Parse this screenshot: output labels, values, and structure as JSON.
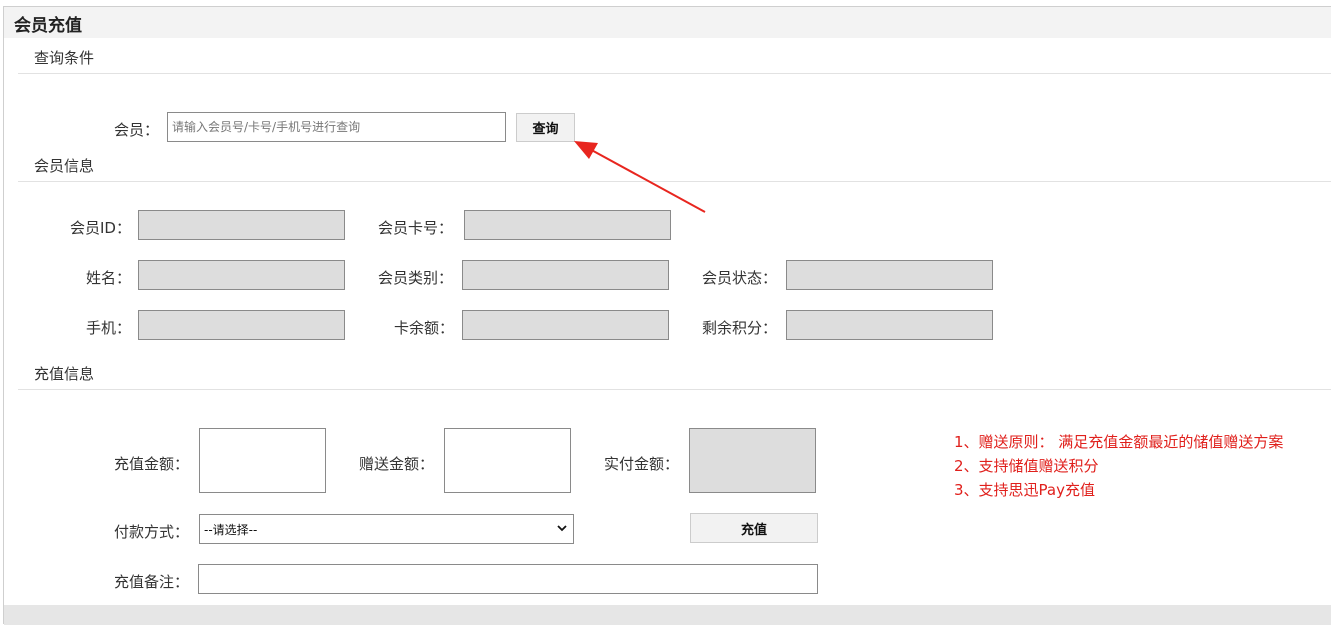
{
  "page": {
    "title": "会员充值"
  },
  "query_section": {
    "title": "查询条件",
    "member_label": "会员：",
    "member_placeholder": "请输入会员号/卡号/手机号进行查询",
    "member_value": "",
    "search_button": "查询"
  },
  "member_info": {
    "title": "会员信息",
    "fields": {
      "member_id": {
        "label": "会员ID：",
        "value": ""
      },
      "member_card_no": {
        "label": "会员卡号：",
        "value": ""
      },
      "name": {
        "label": "姓名：",
        "value": ""
      },
      "member_type": {
        "label": "会员类别：",
        "value": ""
      },
      "member_status": {
        "label": "会员状态：",
        "value": ""
      },
      "phone": {
        "label": "手机：",
        "value": ""
      },
      "card_balance": {
        "label": "卡余额：",
        "value": ""
      },
      "remaining_points": {
        "label": "剩余积分：",
        "value": ""
      }
    }
  },
  "recharge_info": {
    "title": "充值信息",
    "recharge_amount_label": "充值金额：",
    "recharge_amount_value": "",
    "bonus_amount_label": "赠送金额：",
    "bonus_amount_value": "",
    "actual_amount_label": "实付金额：",
    "actual_amount_value": "",
    "payment_label": "付款方式：",
    "payment_selected": "--请选择--",
    "recharge_button": "充值",
    "remark_label": "充值备注：",
    "remark_value": ""
  },
  "notes": [
    "1、赠送原则： 满足充值金额最近的储值赠送方案",
    "2、支持储值赠送积分",
    "3、支持思迅Pay充值"
  ],
  "colors": {
    "note_text": "#e0201c",
    "arrow": "#e8261f",
    "readonly_bg": "#dddddd",
    "title_bar_bg": "#f3f3f3"
  },
  "icons": {
    "payment_dropdown": "chevron-down-icon",
    "annotation": "red-arrow-icon"
  }
}
